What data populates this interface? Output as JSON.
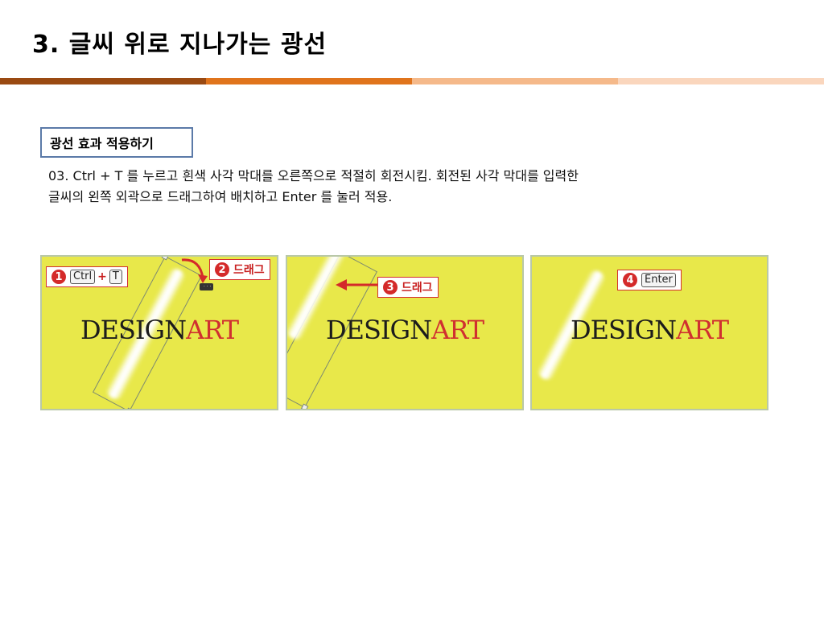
{
  "slide": {
    "title": "3. 글씨 위로 지나가는 광선"
  },
  "section": {
    "label": "광선 효과 적용하기"
  },
  "body": {
    "text": "03. Ctrl + T 를 누르고 흰색 사각 막대를 오른쪽으로 적절히 회전시킴. 회전된 사각 막대를 입력한\n글씨의 왼쪽 외곽으로 드래그하여 배치하고 Enter 를 눌러 적용."
  },
  "panels": [
    {
      "logo_dark": "DESIGN",
      "logo_red": "ART",
      "callouts": [
        {
          "num": "1",
          "key1": "Ctrl",
          "plus": "+",
          "key2": "T"
        },
        {
          "num": "2",
          "text": "드래그"
        }
      ]
    },
    {
      "logo_dark": "DESIGN",
      "logo_red": "ART",
      "callouts": [
        {
          "num": "3",
          "text": "드래그"
        }
      ]
    },
    {
      "logo_dark": "DESIGN",
      "logo_red": "ART",
      "callouts": [
        {
          "num": "4",
          "key": "Enter"
        }
      ]
    }
  ],
  "colors": {
    "panel_bg": "#e8e84a",
    "accent_red": "#d42a2a",
    "title_bar": [
      "#9a4a12",
      "#e0741c",
      "#f5b98a",
      "#fad6bd"
    ]
  }
}
